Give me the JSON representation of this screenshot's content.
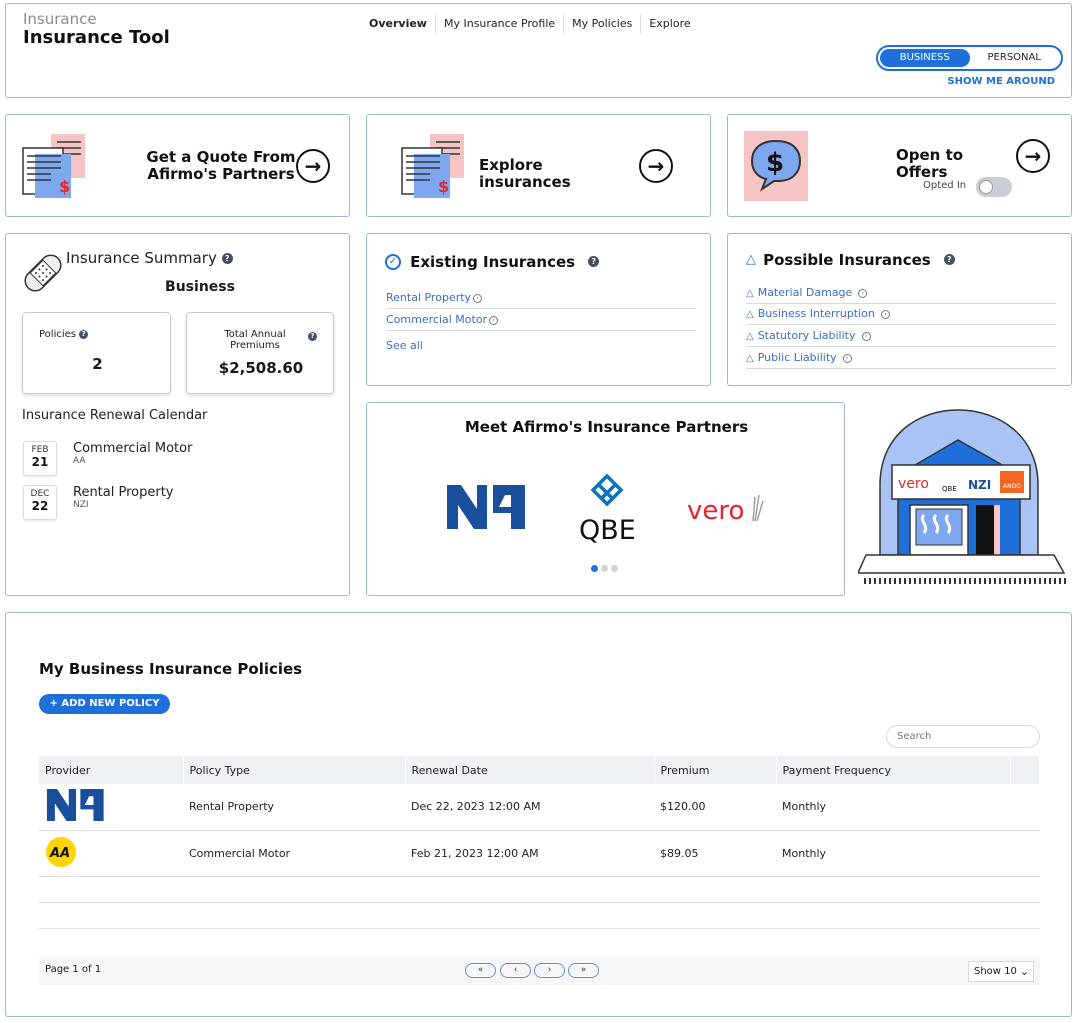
{
  "header": {
    "brand_small": "Insurance",
    "brand_title": "Insurance Tool",
    "nav": [
      "Overview",
      "My Insurance Profile",
      "My Policies",
      "Explore"
    ],
    "toggle_business": "BUSINESS",
    "toggle_personal": "PERSONAL",
    "show_me_around": "SHOW ME AROUND"
  },
  "actions": {
    "quote_line1": "Get a Quote From",
    "quote_line2": "Afirmo's Partners",
    "explore": "Explore insurances",
    "offers": "Open to Offers",
    "opted_in": "Opted In",
    "opted_in_state": false
  },
  "summary": {
    "title": "Insurance Summary",
    "subtitle": "Business",
    "policies_label": "Policies",
    "policies_value": "2",
    "premiums_label_1": "Total Annual",
    "premiums_label_2": "Premiums",
    "premiums_value": "$2,508.60",
    "calendar_title": "Insurance Renewal Calendar",
    "calendar": [
      {
        "month": "FEB",
        "day": "21",
        "title": "Commercial Motor",
        "provider": "AA"
      },
      {
        "month": "DEC",
        "day": "22",
        "title": "Rental Property",
        "provider": "NZI"
      }
    ]
  },
  "existing": {
    "title": "Existing Insurances",
    "items": [
      "Rental Property",
      "Commercial Motor"
    ],
    "see_all": "See all"
  },
  "possible": {
    "title": "Possible Insurances",
    "items": [
      "Material Damage",
      "Business Interruption",
      "Statutory Liability",
      "Public Liability"
    ]
  },
  "partners": {
    "title": "Meet Afirmo's Insurance Partners",
    "logos": [
      "NZI",
      "QBE",
      "vero"
    ],
    "illustration_labels": [
      "vero",
      "QBE",
      "NZI",
      "ANDO"
    ]
  },
  "policies": {
    "title": "My Business Insurance Policies",
    "add_button": "+ ADD NEW POLICY",
    "search_placeholder": "Search",
    "columns": [
      "Provider",
      "Policy Type",
      "Renewal Date",
      "Premium",
      "Payment Frequency"
    ],
    "rows": [
      {
        "provider": "NZI",
        "type": "Rental Property",
        "renewal": "Dec 22, 2023 12:00 AM",
        "premium": "$120.00",
        "frequency": "Monthly"
      },
      {
        "provider": "AA",
        "type": "Commercial Motor",
        "renewal": "Feb 21, 2023 12:00 AM",
        "premium": "$89.05",
        "frequency": "Monthly"
      }
    ],
    "page_info": "Page 1 of 1",
    "show_label": "Show 10",
    "pager_buttons": [
      "«",
      "‹",
      "›",
      "»"
    ]
  },
  "colors": {
    "accent": "#1e6fd9",
    "nzi_blue": "#1a4f9c",
    "qbe_blue": "#0a73c0",
    "vero_red": "#e3262e",
    "aa_yellow": "#ffd400",
    "pink": "#f6c4c4",
    "doc_blue": "#7da7ee"
  }
}
